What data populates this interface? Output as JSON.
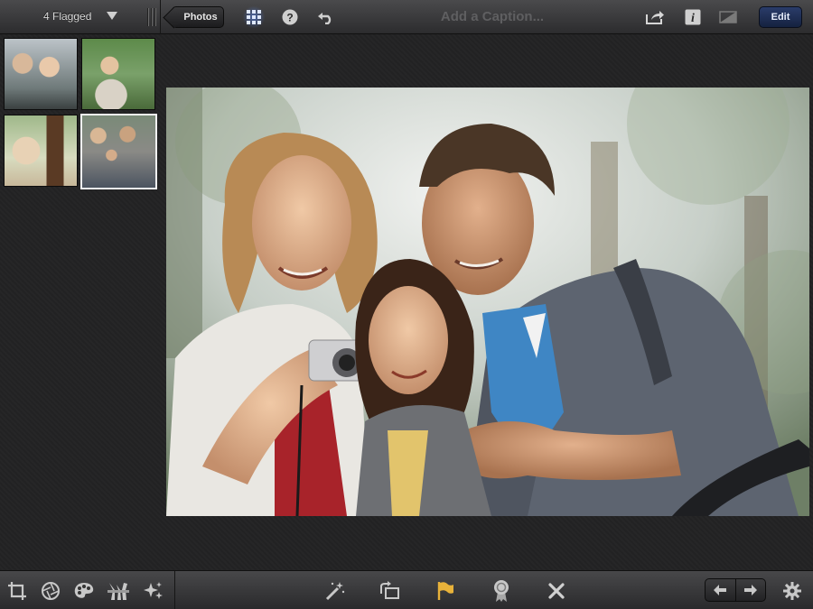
{
  "topbar": {
    "album_title": "4 Flagged",
    "back_label": "Photos",
    "caption_placeholder": "Add a Caption...",
    "edit_label": "Edit"
  },
  "icons": {
    "album_menu": "triangle-down-icon",
    "grid": "grid-icon",
    "help": "question-icon",
    "undo": "undo-icon",
    "share": "share-icon",
    "info": "info-icon",
    "compare": "compare-icon",
    "crop": "crop-icon",
    "exposure": "aperture-icon",
    "color": "palette-icon",
    "brushes": "brushes-icon",
    "effects": "sparkle-icon",
    "auto_enhance": "magic-wand-icon",
    "rotate": "rotate-icon",
    "flag": "flag-icon",
    "favorite": "ribbon-icon",
    "hide": "x-icon",
    "previous": "arrow-left-icon",
    "next": "arrow-right-icon",
    "settings": "gear-icon"
  },
  "thumbnails": [
    {
      "name": "child-with-grandmother"
    },
    {
      "name": "girl-with-camera"
    },
    {
      "name": "girl-in-hammock"
    },
    {
      "name": "family-with-camera",
      "selected": true
    }
  ],
  "colors": {
    "flag_active": "#e8b23a",
    "grid_active": "#5a8cff",
    "edit_button": "#1f2f57"
  }
}
